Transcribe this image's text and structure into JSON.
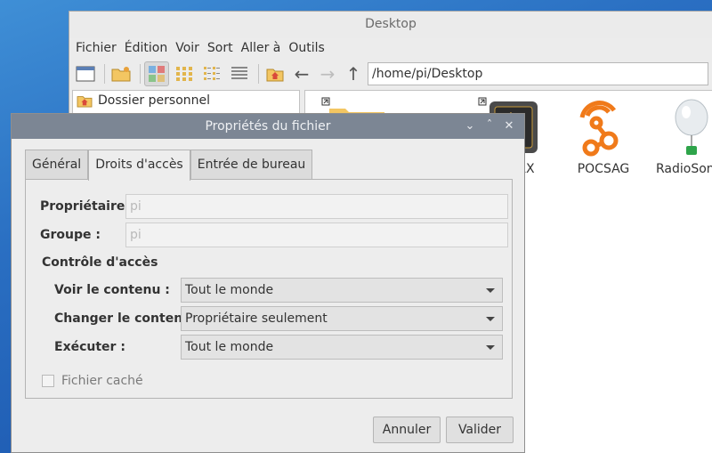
{
  "file_manager": {
    "title": "Desktop",
    "menu": [
      "Fichier",
      "Édition",
      "Voir",
      "Sort",
      "Aller à",
      "Outils"
    ],
    "path": "/home/pi/Desktop",
    "sidebar": {
      "items": [
        {
          "label": "Dossier personnel",
          "icon": "home-folder-icon"
        }
      ]
    },
    "desktop_items": [
      {
        "label": "",
        "icon": "folder-icon"
      },
      {
        "label": "RX",
        "icon": "sdr-app-icon"
      },
      {
        "label": "POCSAG",
        "icon": "pocsag-icon"
      },
      {
        "label": "RadioSonde",
        "icon": "balloon-icon"
      }
    ]
  },
  "dialog": {
    "title": "Propriétés du fichier",
    "tabs": [
      "Général",
      "Droits d'accès",
      "Entrée de bureau"
    ],
    "active_tab": 1,
    "owner": {
      "label": "Propriétaire :",
      "value": "pi"
    },
    "group": {
      "label": "Groupe :",
      "value": "pi"
    },
    "access_heading": "Contrôle d'accès",
    "access_rows": [
      {
        "label": "Voir le contenu :",
        "value": "Tout le monde"
      },
      {
        "label": "Changer le contenu :",
        "value": "Propriétaire seulement"
      },
      {
        "label": "Exécuter :",
        "value": "Tout le monde"
      }
    ],
    "hidden_file": {
      "label": "Fichier caché",
      "checked": false
    },
    "cancel_label": "Annuler",
    "ok_label": "Valider"
  },
  "colors": {
    "desktop_bg": "#2a6fc2",
    "dialog_titlebar": "#7c8694",
    "pocsag_orange": "#f07a1a"
  }
}
